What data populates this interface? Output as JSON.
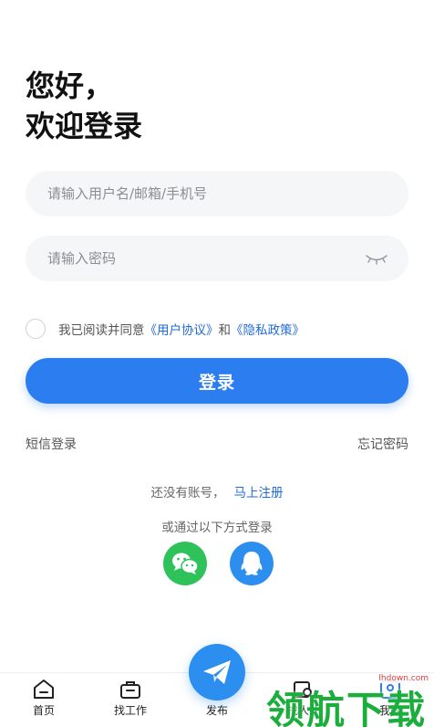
{
  "greeting": {
    "line1": "您好，",
    "line2": "欢迎登录"
  },
  "form": {
    "username_placeholder": "请输入用户名/邮箱/手机号",
    "username_value": "",
    "password_placeholder": "请输入密码",
    "password_value": "",
    "password_toggle_icon": "eye-closed-icon"
  },
  "agreement": {
    "checked": false,
    "prefix": "我已阅读并同意",
    "user_agreement": "《用户协议》",
    "and": "和",
    "privacy_policy": "《隐私政策》"
  },
  "login_button": "登录",
  "sms_login": "短信登录",
  "forgot_password": "忘记密码",
  "register": {
    "prompt": "还没有账号，",
    "link": "马上注册"
  },
  "other_methods": {
    "label": "或通过以下方式登录",
    "options": [
      {
        "icon": "wechat-icon",
        "color": "#2fc25b"
      },
      {
        "icon": "qq-icon",
        "color": "#2c8ff0"
      }
    ]
  },
  "tabbar": {
    "home": "首页",
    "jobs": "找工作",
    "publish": "发布",
    "talent": "找人才",
    "mine": "我的"
  },
  "watermark": {
    "text": "领航下载",
    "url": "lhdown.com"
  },
  "colors": {
    "primary": "#2c7ef0",
    "link": "#1f6bd9",
    "wechat": "#2fc25b",
    "input_bg": "#f5f6f8"
  }
}
